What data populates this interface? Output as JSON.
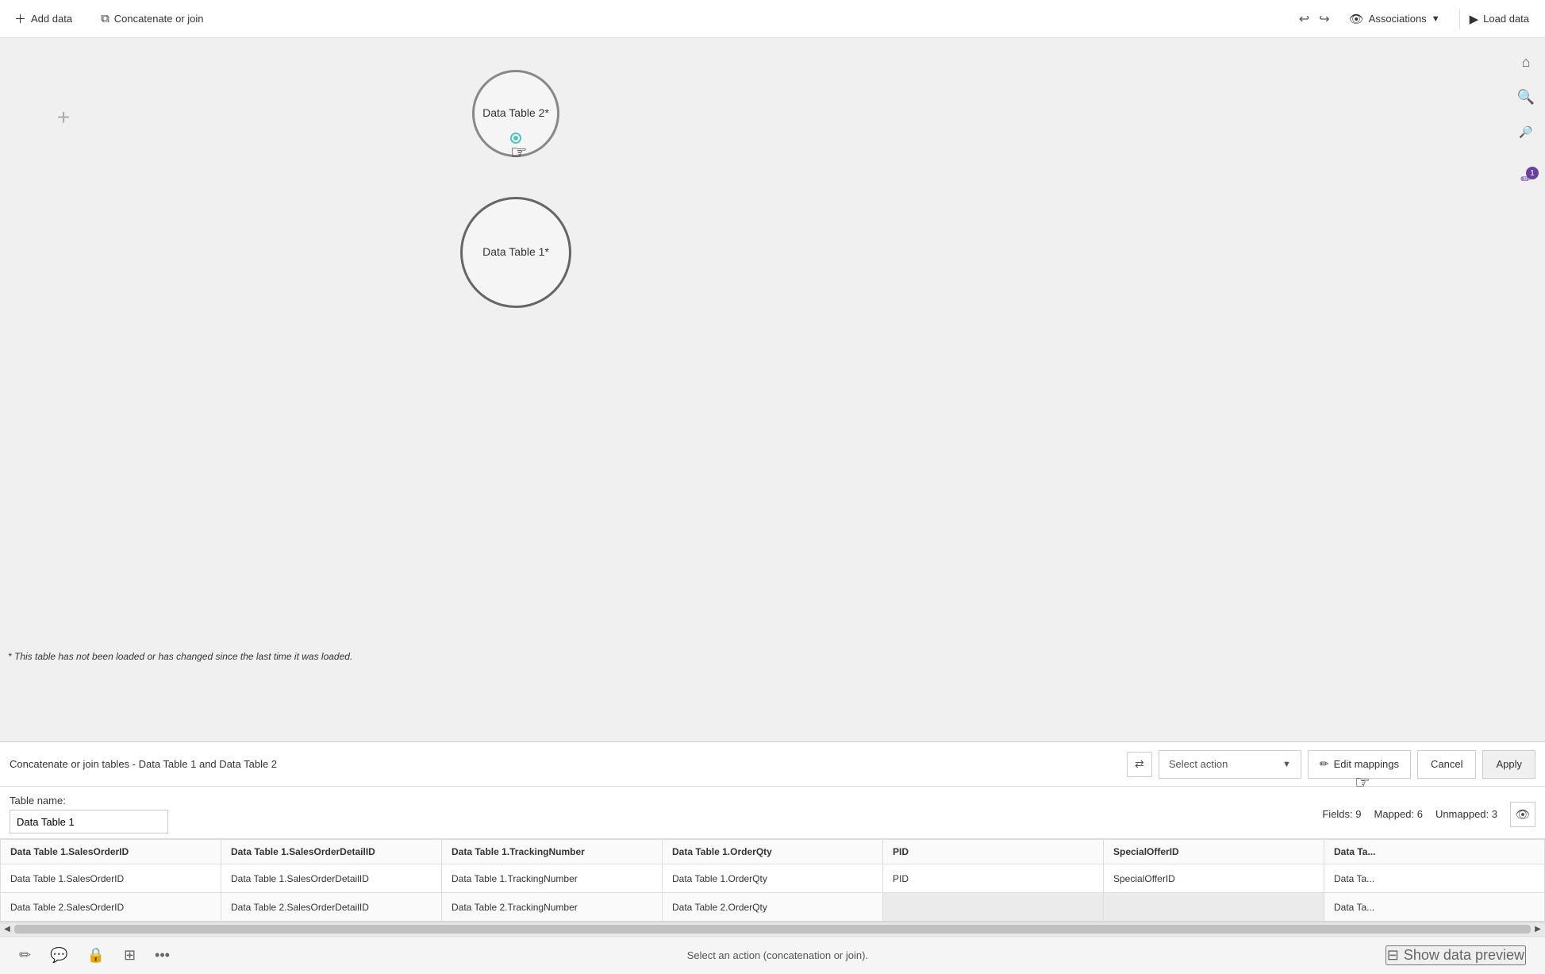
{
  "topbar": {
    "add_data_label": "Add data",
    "concatenate_label": "Concatenate or join",
    "associations_label": "Associations",
    "load_data_label": "Load data"
  },
  "canvas": {
    "plus_icon": "+",
    "table2_label": "Data Table 2*",
    "table1_label": "Data Table 1*",
    "note": "* This table has not been loaded or has changed since the last time it was loaded."
  },
  "toolbar": {
    "title": "Concatenate or join tables - Data Table 1 and Data Table 2",
    "swap_icon": "⇄",
    "select_action_label": "Select action",
    "edit_mappings_label": "Edit mappings",
    "cancel_label": "Cancel",
    "apply_label": "Apply"
  },
  "table_name_section": {
    "label": "Table name:",
    "value": "Data Table 1",
    "fields_label": "Fields: 9",
    "mapped_label": "Mapped: 6",
    "unmapped_label": "Unmapped: 3"
  },
  "data_columns": [
    "Data Table 1.SalesOrderID",
    "Data Table 1.SalesOrderDetailID",
    "Data Table 1.TrackingNumber",
    "Data Table 1.OrderQty",
    "PID",
    "SpecialOfferID",
    "Data Ta..."
  ],
  "data_rows": [
    [
      "Data Table 1.SalesOrderID",
      "Data Table 1.SalesOrderDetailID",
      "Data Table 1.TrackingNumber",
      "Data Table 1.OrderQty",
      "PID",
      "SpecialOfferID",
      "Data Ta..."
    ],
    [
      "Data Table 2.SalesOrderID",
      "Data Table 2.SalesOrderDetailID",
      "Data Table 2.TrackingNumber",
      "Data Table 2.OrderQty",
      "",
      "",
      "Data Ta..."
    ]
  ],
  "status_bar": {
    "message": "Select an action (concatenation or join).",
    "icons": [
      "pencil-icon",
      "chat-icon",
      "lock-icon",
      "grid-icon",
      "more-icon"
    ],
    "show_data_preview_label": "Show data preview"
  }
}
